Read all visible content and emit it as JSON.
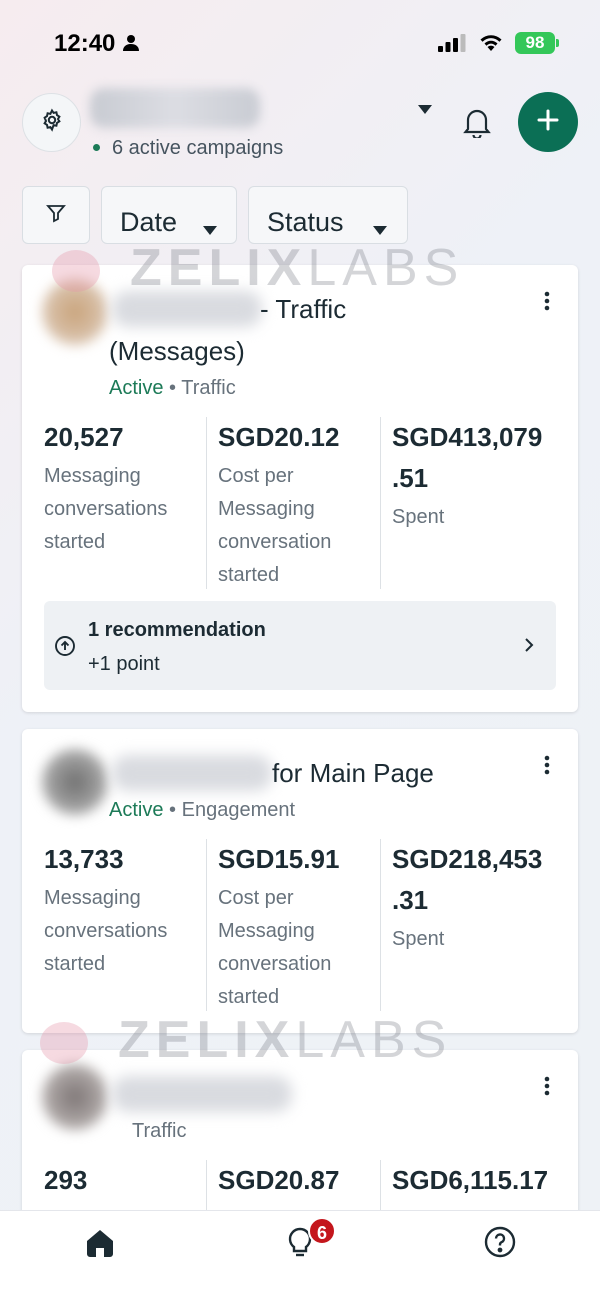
{
  "status_bar": {
    "time": "12:40",
    "battery": "98"
  },
  "header": {
    "campaign_count": "6 active campaigns"
  },
  "filters": {
    "date_label": "Date",
    "status_label": "Status"
  },
  "watermark": {
    "brand_bold": "ZELIX",
    "brand_light": "LABS"
  },
  "campaigns": [
    {
      "title_line1": "- Traffic",
      "title_line2": "(Messages)",
      "status": "Active",
      "separator": "•",
      "objective": "Traffic",
      "metrics": [
        {
          "value": "20,527",
          "label_lines": [
            "Messaging",
            "conversations",
            "started"
          ]
        },
        {
          "value": "SGD20.12",
          "label_lines": [
            "Cost per",
            "Messaging",
            "conversation",
            "started"
          ]
        },
        {
          "value_lines": [
            "SGD413,079",
            ".51"
          ],
          "label_lines": [
            "Spent"
          ]
        }
      ],
      "recommendation": {
        "title": "1 recommendation",
        "subtitle": "+1 point"
      }
    },
    {
      "title_line1": "for Main Page",
      "status": "Active",
      "separator": "•",
      "objective": "Engagement",
      "metrics": [
        {
          "value": "13,733",
          "label_lines": [
            "Messaging",
            "conversations",
            "started"
          ]
        },
        {
          "value": "SGD15.91",
          "label_lines": [
            "Cost per",
            "Messaging",
            "conversation",
            "started"
          ]
        },
        {
          "value_lines": [
            "SGD218,453",
            ".31"
          ],
          "label_lines": [
            "Spent"
          ]
        }
      ]
    },
    {
      "objective": "Traffic",
      "metrics": [
        {
          "value": "293"
        },
        {
          "value": "SGD20.87"
        },
        {
          "value": "SGD6,115.17"
        }
      ]
    }
  ],
  "bottom_nav": {
    "ideas_badge": "6"
  },
  "colors": {
    "accent_green": "#0b6f55",
    "active_text": "#1c7a57",
    "badge_red": "#c4161c"
  }
}
